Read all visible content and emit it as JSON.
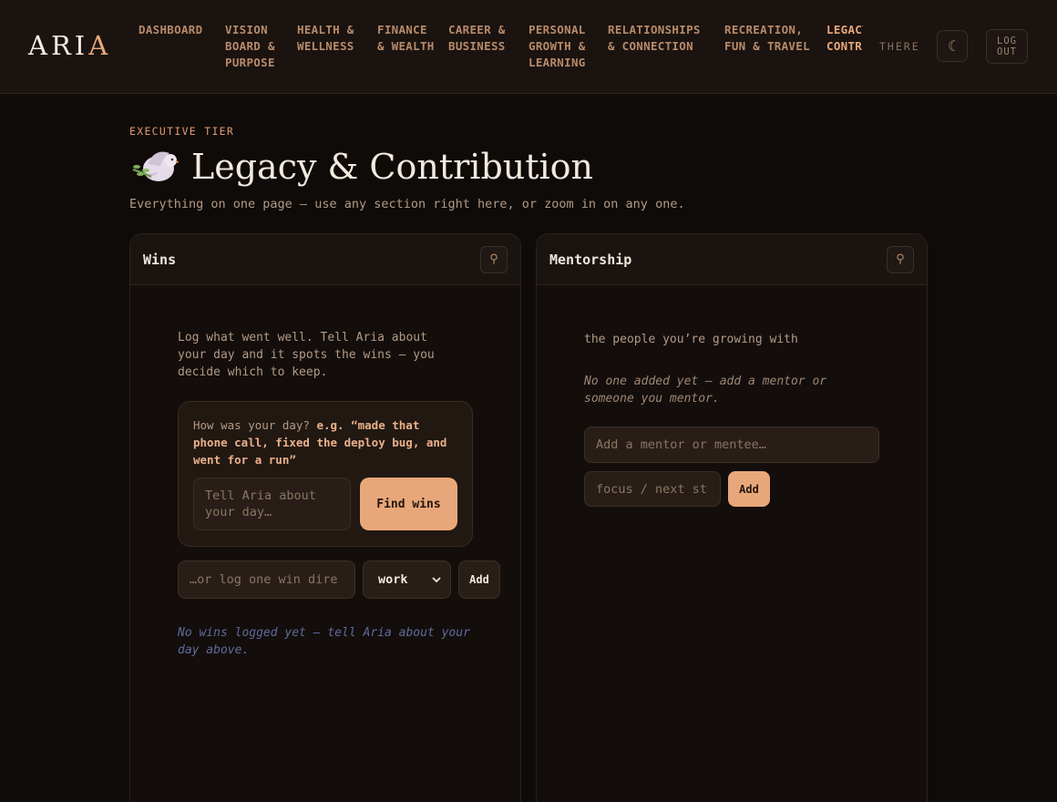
{
  "brand": {
    "logo_main": "ARI",
    "logo_accent": "A"
  },
  "nav": {
    "items": [
      {
        "label": "DASHBOARD"
      },
      {
        "label": "VISION BOARD & PURPOSE"
      },
      {
        "label": "HEALTH & WELLNESS"
      },
      {
        "label": "FINANCE & WEALTH"
      },
      {
        "label": "CAREER & BUSINESS"
      },
      {
        "label": "PERSONAL GROWTH & LEARNING"
      },
      {
        "label": "RELATIONSHIPS & CONNECTION"
      },
      {
        "label": "RECREATION, FUN & TRAVEL"
      },
      {
        "label": "LEGACY & CONTRIBUTION"
      }
    ],
    "user_label": "THERE",
    "theme_icon": "☾",
    "logout_label": "LOG OUT"
  },
  "header": {
    "tier": "EXECUTIVE TIER",
    "title": "Legacy & Contribution",
    "title_icon": "dove-icon",
    "subtitle": "Everything on one page — use any section right here, or zoom in on any one."
  },
  "wins": {
    "title": "Wins",
    "pin_icon": "⚲",
    "intro": "Log what went well. Tell Aria about your day and it spots the wins — you decide which to keep.",
    "ask_prompt": "How was your day?",
    "ask_example": "e.g. “made that phone call, fixed the deploy bug, and went for a run”",
    "day_placeholder": "Tell Aria about your day…",
    "find_button": "Find wins",
    "direct_placeholder": "…or log one win dire",
    "category_value": "work",
    "add_button": "Add",
    "empty_text": "No wins logged yet — tell Aria about your day above."
  },
  "mentorship": {
    "title": "Mentorship",
    "pin_icon": "⚲",
    "intro": "the people you’re growing with",
    "empty_text": "No one added yet — add a mentor or someone you mentor.",
    "name_placeholder": "Add a mentor or mentee…",
    "focus_placeholder": "focus / next st",
    "add_button": "Add"
  },
  "colors": {
    "accent": "#e8a77a",
    "background": "#0f0b09",
    "empty_blue": "#5f6b9a"
  }
}
